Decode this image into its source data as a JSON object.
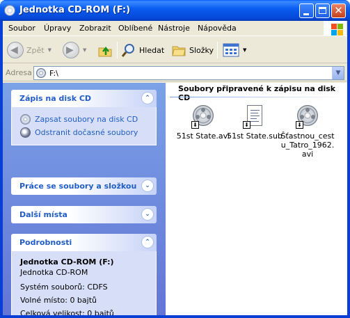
{
  "window": {
    "title": "Jednotka CD-ROM (F:)",
    "minimize_label": "_",
    "maximize_label": "□",
    "close_label": "✕"
  },
  "menubar": {
    "items": [
      {
        "label": "Soubor"
      },
      {
        "label": "Úpravy"
      },
      {
        "label": "Zobrazit"
      },
      {
        "label": "Oblíbené"
      },
      {
        "label": "Nástroje"
      },
      {
        "label": "Nápověda"
      }
    ]
  },
  "toolbar": {
    "back_label": "Zpět",
    "forward_icon": "forward-arrow-icon",
    "up_icon": "folder-up-icon",
    "search_label": "Hledat",
    "folders_label": "Složky",
    "views_icon": "views-icon"
  },
  "address": {
    "label": "Adresa",
    "value": "F:\\"
  },
  "tasks": {
    "cd_panel": {
      "title": "Zápis na disk CD",
      "links": [
        {
          "label": "Zapsat soubory na disk CD",
          "icon": "cd-write-icon"
        },
        {
          "label": "Odstranit dočasné soubory",
          "icon": "delete-temp-icon"
        }
      ]
    },
    "files_panel": {
      "title": "Práce se soubory a složkou"
    },
    "places_panel": {
      "title": "Další místa"
    },
    "details_panel": {
      "title": "Podrobnosti",
      "name": "Jednotka CD-ROM (F:)",
      "type": "Jednotka CD-ROM",
      "filesystem": "Systém souborů: CDFS",
      "free": "Volné místo: 0 bajtů",
      "total": "Celková velikost: 0 bajtů"
    }
  },
  "content": {
    "group_title": "Soubory připravené k zápisu na disk CD",
    "files": [
      {
        "name": "51st State.avi",
        "icon": "video-file-icon"
      },
      {
        "name": "51st State.sub",
        "icon": "text-file-icon"
      },
      {
        "name": "Šťastnou_cestu_Tatro_1962.avi",
        "icon": "video-file-icon"
      }
    ]
  }
}
